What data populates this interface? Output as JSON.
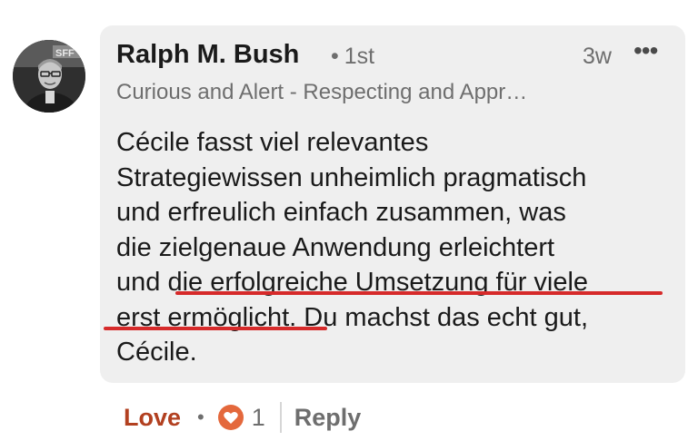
{
  "comment": {
    "author": "Ralph M. Bush",
    "connection_separator": "•",
    "connection_degree": "1st",
    "timestamp": "3w",
    "more_label": "•••",
    "headline": "Curious and Alert - Respecting and Appr…",
    "avatar_sign_text": "SFF",
    "body_lines": {
      "l1": "Cécile fasst viel relevantes",
      "l2": "Strategiewissen unheimlich pragmatisch",
      "l3": "und erfreulich einfach zusammen, was",
      "l4": "die zielgenaue Anwendung erleichtert",
      "l5_a": "und ",
      "l5_b": "die erfolgreiche Umsetzung für viele",
      "l6_a": "erst ermöglicht.",
      "l6_b": " Du machst das echt gut,",
      "l7": "Cécile."
    }
  },
  "actions": {
    "love_label": "Love",
    "separator": "•",
    "reaction_icon": "heart-reaction-icon",
    "reaction_count": "1",
    "reply_label": "Reply"
  },
  "colors": {
    "bubble": "#efefef",
    "love": "#b24020",
    "underline_annotation": "#d62a2a",
    "reaction_badge": "#e4683c"
  }
}
